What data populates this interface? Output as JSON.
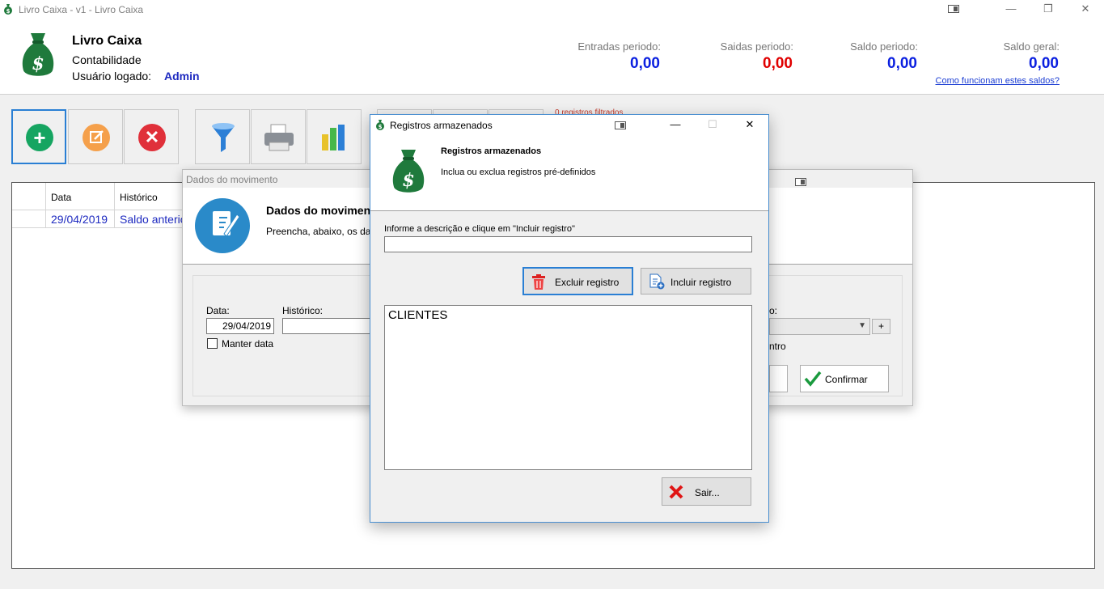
{
  "window": {
    "title": "Livro Caixa - v1 - Livro Caixa",
    "minimize": "—",
    "maximize": "❐",
    "close": "✕"
  },
  "header": {
    "app_name": "Livro Caixa",
    "subtitle": "Contabilidade",
    "user_label": "Usuário logado:",
    "user_name": "Admin",
    "stats": [
      {
        "label": "Entradas periodo:",
        "value": "0,00",
        "color": "#0a1fe0"
      },
      {
        "label": "Saidas periodo:",
        "value": "0,00",
        "color": "#e00000"
      },
      {
        "label": "Saldo periodo:",
        "value": "0,00",
        "color": "#0a1fe0"
      },
      {
        "label": "Saldo geral:",
        "value": "0,00",
        "color": "#0a1fe0"
      }
    ],
    "help_link": "Como funcionam estes saldos?"
  },
  "toolbar": {
    "filter_note": "0 registros filtrados"
  },
  "grid": {
    "columns": [
      "Data",
      "Histórico"
    ],
    "rows": [
      {
        "data": "29/04/2019",
        "historico": "Saldo anterior"
      }
    ]
  },
  "movimento_dialog": {
    "title": "Dados do movimento",
    "heading": "Dados do movimento",
    "subheading": "Preencha, abaixo, os dados",
    "data_label": "Data:",
    "data_value": "29/04/2019",
    "historico_label": "Histórico:",
    "manter_label": "Manter data",
    "combo_label_tail": "o:",
    "centro_tail": "ntro",
    "plus": "+",
    "confirm_label": "Confirmar"
  },
  "registros_dialog": {
    "title": "Registros armazenados",
    "heading": "Registros armazenados",
    "subheading": "Inclua ou exclua registros pré-definidos",
    "input_label": "Informe a descrição e clique em \"Incluir registro\"",
    "input_value": "",
    "excluir_label": "Excluir registro",
    "incluir_label": "Incluir registro",
    "items": [
      "CLIENTES"
    ],
    "sair_label": "Sair...",
    "minimize": "—",
    "maximize": "☐",
    "close": "✕"
  },
  "colors": {
    "add": "#16a561",
    "edit": "#f5a04b",
    "delete": "#e0303a",
    "bag_green": "#1f7a3c"
  }
}
